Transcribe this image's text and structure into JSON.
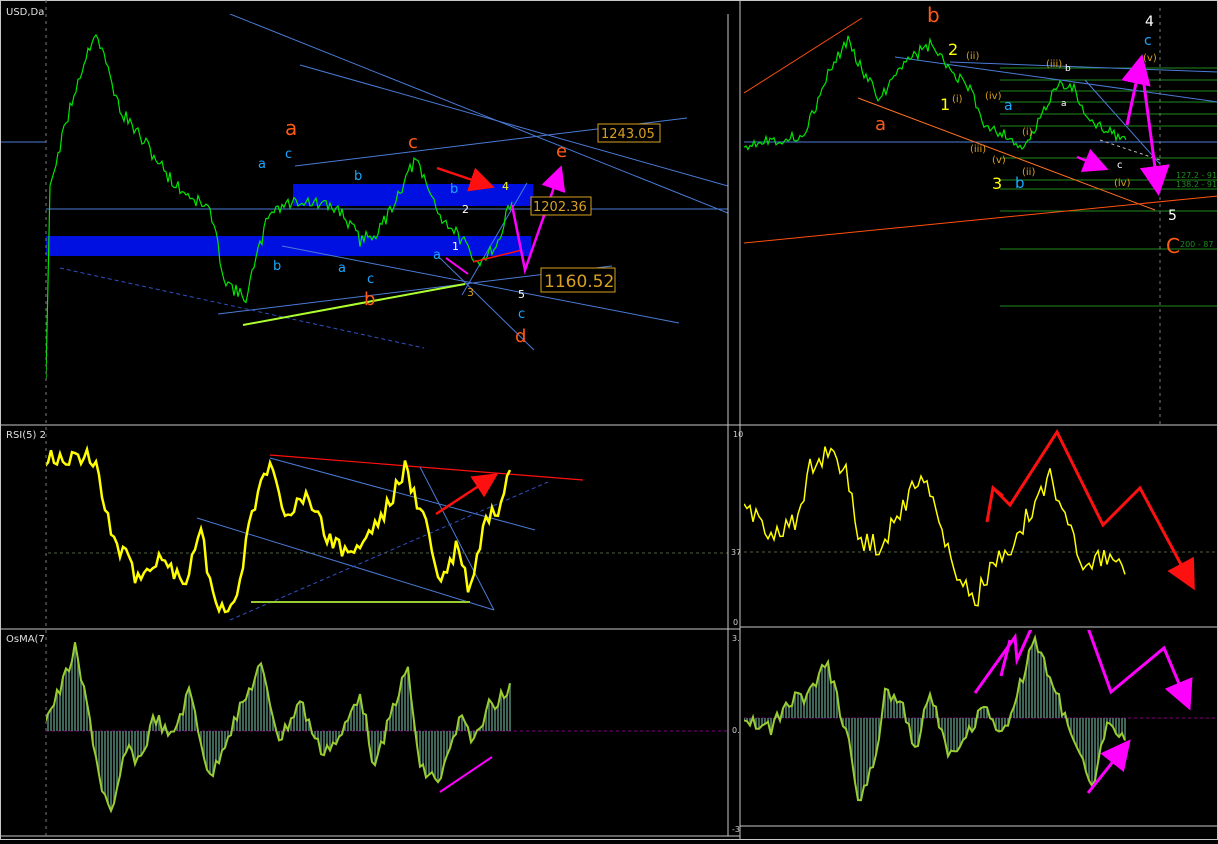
{
  "colors": {
    "background": "#000000",
    "border": "#c8c8c8",
    "price": "#00e600",
    "rsi": "#ffff00",
    "osma_line": "#9acd32",
    "osma_hist": "#4f7f6f",
    "trend": "#4a7bd6",
    "zone": "#0010e0",
    "magenta": "#ff00ff",
    "red": "#ff1010",
    "orange": "#ff6010",
    "cyan": "#00a0ff",
    "yellow": "#ffff00",
    "tan": "#d9a020",
    "lime": "#adff2f"
  },
  "left": {
    "symbol_label": "USD,Da",
    "price_tags": [
      "1243.05",
      "1202.36",
      "1160.52"
    ],
    "rsi_label": "RSI(5) 2",
    "osma_label": "OsMA(7"
  },
  "right": {
    "rsi_scale": [
      "10",
      "37",
      "0"
    ],
    "osma_scale": [
      "3.",
      "0.",
      "-3"
    ],
    "fib_labels": [
      "127.2 - 91",
      "138.2 - 91",
      "200 - 87"
    ]
  },
  "wave_labels": [
    {
      "t": "a",
      "c": "orange"
    },
    {
      "t": "c",
      "c": "cyan"
    },
    {
      "t": "a",
      "c": "cyan"
    },
    {
      "t": "c",
      "c": "orange"
    },
    {
      "t": "b",
      "c": "cyan"
    },
    {
      "t": "b",
      "c": "cyan"
    },
    {
      "t": "a",
      "c": "cyan"
    },
    {
      "t": "c",
      "c": "cyan"
    },
    {
      "t": "b",
      "c": "orange"
    },
    {
      "t": "b",
      "c": "cyan"
    },
    {
      "t": "4",
      "c": "yellow"
    },
    {
      "t": "2",
      "c": "white"
    },
    {
      "t": "1",
      "c": "white"
    },
    {
      "t": "a",
      "c": "cyan"
    },
    {
      "t": "3",
      "c": "tan"
    },
    {
      "t": "5",
      "c": "white"
    },
    {
      "t": "c",
      "c": "cyan"
    },
    {
      "t": "d",
      "c": "orange"
    },
    {
      "t": "e",
      "c": "orange"
    },
    {
      "t": "b",
      "c": "orange"
    },
    {
      "t": "a",
      "c": "orange"
    },
    {
      "t": "2",
      "c": "yellow"
    },
    {
      "t": "1",
      "c": "yellow"
    },
    {
      "t": "3",
      "c": "yellow"
    },
    {
      "t": "b",
      "c": "cyan"
    },
    {
      "t": "a",
      "c": "cyan"
    },
    {
      "t": "4",
      "c": "white"
    },
    {
      "t": "c",
      "c": "cyan"
    },
    {
      "t": "(v)",
      "c": "tan"
    },
    {
      "t": "(ii)",
      "c": "tan"
    },
    {
      "t": "(i)",
      "c": "tan"
    },
    {
      "t": "(iv)",
      "c": "tan"
    },
    {
      "t": "(iii)",
      "c": "tan"
    },
    {
      "t": "(v)",
      "c": "tan"
    },
    {
      "t": "(i)",
      "c": "tan"
    },
    {
      "t": "(ii)",
      "c": "tan"
    },
    {
      "t": "(iii)",
      "c": "tan"
    },
    {
      "t": "(iv)",
      "c": "tan"
    },
    {
      "t": "b",
      "c": "white"
    },
    {
      "t": "a",
      "c": "white"
    },
    {
      "t": "c",
      "c": "white"
    },
    {
      "t": "5",
      "c": "white"
    },
    {
      "t": "C",
      "c": "orange"
    }
  ],
  "chart_data": [
    {
      "type": "line",
      "name": "price-left",
      "x": [
        0,
        1
      ],
      "values": [
        0,
        0
      ]
    },
    {
      "type": "line",
      "name": "rsi-left",
      "values": [
        0,
        100
      ]
    },
    {
      "type": "bar",
      "name": "osma-left",
      "values": [
        0
      ]
    },
    {
      "type": "line",
      "name": "price-right",
      "values": [
        0,
        0
      ]
    },
    {
      "type": "line",
      "name": "rsi-right",
      "values": [
        0,
        100
      ]
    },
    {
      "type": "bar",
      "name": "osma-right",
      "values": [
        0
      ]
    }
  ]
}
